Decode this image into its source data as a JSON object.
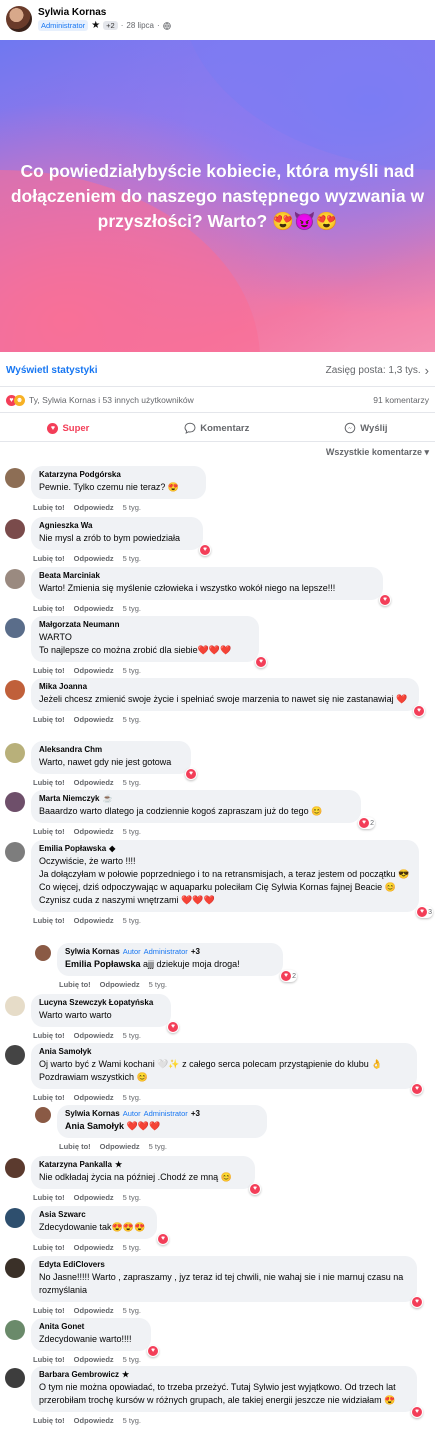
{
  "post": {
    "author": "Sylwia Kornas",
    "role": "Administrator",
    "badge_extra": "+2",
    "date": "28 lipca",
    "separator": "·",
    "privacy_icon": "globe-icon",
    "text": "Co powiedziałybyście kobiecie, która myśli nad dołączeniem do naszego następnego wyzwania w przyszłości? Warto? 😍😈😍",
    "bg_colors": [
      "#6f78f0",
      "#a876e6",
      "#f27aa6"
    ]
  },
  "stats": {
    "link": "Wyświetl statystyki",
    "reach": "Zasięg posta: 1,3 tys."
  },
  "reactions": {
    "summary": "Ty, Sylwia Kornas i 53 innych użytkowników",
    "comments_count": "91 komentarzy"
  },
  "actions": {
    "love": "Super",
    "comment": "Komentarz",
    "share": "Wyślij"
  },
  "sort_label": "Wszystkie komentarze",
  "footer": {
    "like": "Lubię to!",
    "reply": "Odpowiedz",
    "time": "5 tyg."
  },
  "comments": [
    {
      "name": "Katarzyna Podgórska",
      "text": "Pewnie. Tylko czemu nie teraz? 😍"
    },
    {
      "name": "Agnieszka Wa",
      "text": "Nie mysl a zrób to bym powiedziała"
    },
    {
      "name": "Beata Marciniak",
      "text": "Warto! Zmienia się myślenie człowieka i wszystko wokół niego na lepsze!!!"
    },
    {
      "name": "Małgorzata Neumann",
      "text": "WARTO\nTo najlepsze co można zrobić dla siebie❤️❤️❤️"
    },
    {
      "name": "Mika Joanna",
      "text": "Jeżeli chcesz zmienić swoje życie i spełniać swoje marzenia to nawet się nie zastanawiaj ❤️"
    },
    {
      "name": "Aleksandra Chm",
      "text": "Warto, nawet gdy nie jest gotowa"
    },
    {
      "name": "Marta Niemczyk",
      "text": "Baaardzo warto dlatego ja codziennie kogoś zapraszam już do tego 😊",
      "count": "2"
    },
    {
      "name": "Emilia Popławska",
      "text": "Oczywiście, że warto !!!!\nJa dołączyłam w połowie poprzedniego i to na retransmisjach, a teraz jestem od początku 😎\nCo więcej, dziś odpoczywając w aquaparku poleciłam Cię Sylwia Kornas fajnej Beacie 😊 Czynisz cuda z naszymi wnętrzami ❤️❤️❤️",
      "count": "3"
    },
    {
      "name": "Sylwia Kornas",
      "author_tag": "Autor",
      "role_tag": "Administrator",
      "extra": "+3",
      "mention": "Emilia Popławska",
      "text": " ajjj dziekuje moja droga!",
      "count": "2"
    },
    {
      "name": "Lucyna Szewczyk Łopatyńska",
      "text": "Warto warto warto"
    },
    {
      "name": "Ania Samołyk",
      "text": "Oj warto być z Wami kochani 🤍✨ z całego serca polecam przystąpienie do klubu 👌 Pozdrawiam wszystkich 😊"
    },
    {
      "name": "Sylwia Kornas",
      "author_tag": "Autor",
      "role_tag": "Administrator",
      "extra": "+3",
      "mention": "Ania Samołyk",
      "text": " ❤️❤️❤️"
    },
    {
      "name": "Katarzyna Pankalla",
      "text": "Nie odkładaj życia na później .Chodź ze mną 😊"
    },
    {
      "name": "Asia Szwarc",
      "text": "Zdecydowanie tak😍😍😍"
    },
    {
      "name": "Edyta EdiClovers",
      "text": "No Jasne!!!!! Warto , zapraszamy , jyz teraz id tej chwili, nie wahaj sie i nie marnuj czasu na rozmyślania"
    },
    {
      "name": "Anita Gonet",
      "text": "Zdecydowanie warto!!!!"
    },
    {
      "name": "Barbara Gembrowicz",
      "text": "O tym nie można opowiadać, to trzeba przeżyć. Tutaj Sylwio jest wyjątkowo. Od trzech lat przerobiłam trochę kursów w różnych grupach, ale takiej energii jeszcze nie widziałam 😍"
    }
  ]
}
